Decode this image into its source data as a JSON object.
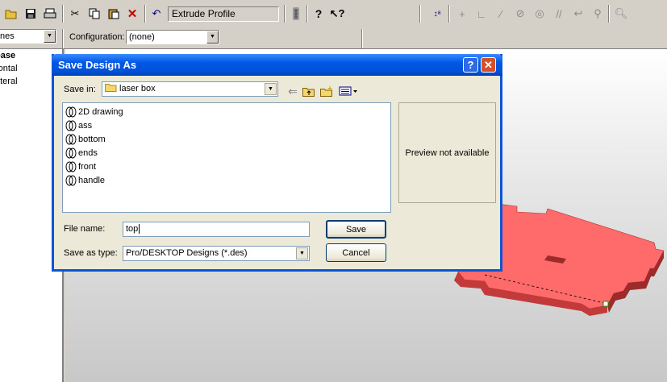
{
  "toolbar": {
    "command_label": "Extrude Profile"
  },
  "bar2": {
    "left_combo_value": "nes",
    "configuration_label": "Configuration:",
    "configuration_value": "(none)"
  },
  "tree": {
    "items": [
      "base",
      "rontal",
      "ateral"
    ]
  },
  "dialog": {
    "title": "Save Design As",
    "save_in_label": "Save in:",
    "save_in_value": "laser box",
    "files": [
      "2D drawing",
      "ass",
      "bottom",
      "ends",
      "front",
      "handle"
    ],
    "preview_text": "Preview not available",
    "file_name_label": "File name:",
    "file_name_value": "top",
    "save_as_type_label": "Save as type:",
    "save_as_type_value": "Pro/DESKTOP Designs (*.des)",
    "save_button": "Save",
    "cancel_button": "Cancel",
    "help_button": "?",
    "close_button": "✕"
  },
  "colors": {
    "model_fill": "#ff6a6a",
    "title_bar": "#0058e6",
    "dialog_bg": "#ece9d8"
  }
}
